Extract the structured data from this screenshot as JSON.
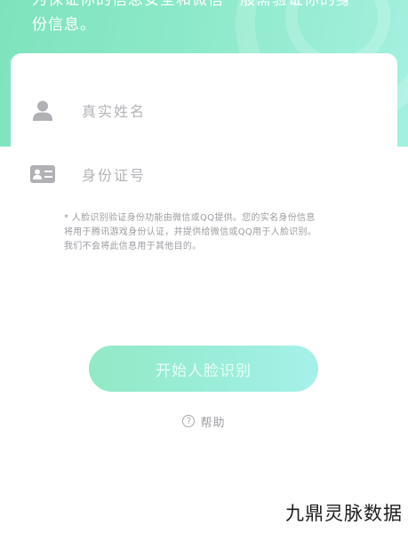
{
  "header": {
    "lines": [
      "为保证你的信息安全和微信一般需验证你的身",
      "份信息。"
    ]
  },
  "form": {
    "name_placeholder": "真实姓名",
    "id_placeholder": "身份证号",
    "icons": {
      "name": "person-icon",
      "id": "id-card-icon"
    }
  },
  "notice": {
    "lines": [
      "* 人脸识别验证身份功能由微信或QQ提供。您的实名身份信息",
      "将用于腾讯游戏身份认证，并提供给微信或QQ用于人脸识别。",
      "我们不会将此信息用于其他目的。"
    ]
  },
  "actions": {
    "start_label": "开始人脸识别",
    "help_label": "帮助",
    "help_icon": "question-circle-icon"
  },
  "watermark": {
    "text": "九鼎灵脉数据"
  },
  "colors": {
    "accent": "#8fe8c8",
    "button_start": "#93e9c5",
    "button_end": "#a6f0ea",
    "placeholder": "#b4b4b9",
    "icon": "#b0b0b5"
  }
}
